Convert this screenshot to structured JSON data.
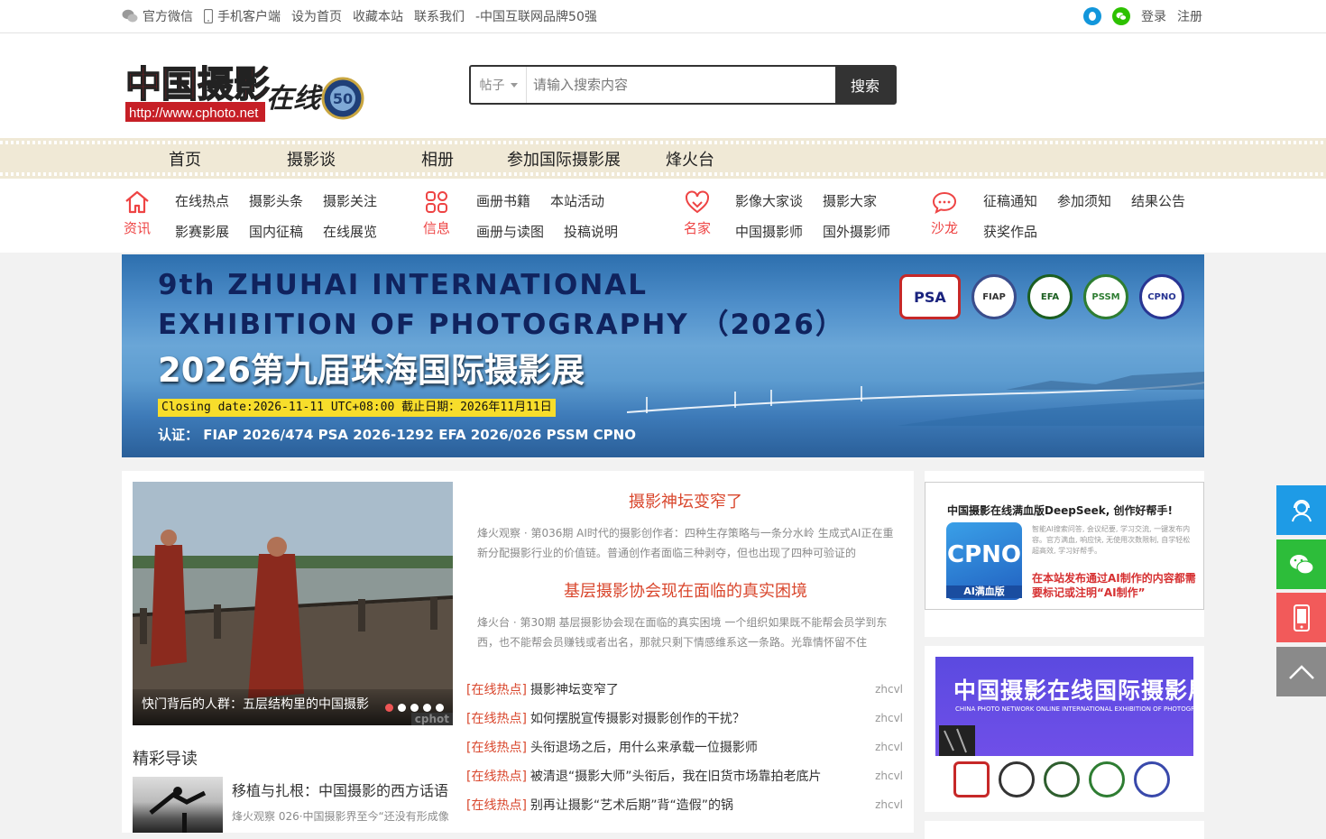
{
  "topbar": {
    "wechat": "官方微信",
    "mobile": "手机客户端",
    "set_home": "设为首页",
    "bookmark": "收藏本站",
    "contact": "联系我们",
    "brand": "-中国互联网品牌50强",
    "login": "登录",
    "register": "注册"
  },
  "logo": {
    "title": "中国摄影",
    "script": "在线",
    "url": "http://www.cphoto.net",
    "badge": "50"
  },
  "search": {
    "scope": "帖子",
    "placeholder": "请输入搜索内容",
    "button": "搜索"
  },
  "nav": [
    "首页",
    "摄影谈",
    "相册",
    "参加国际摄影展",
    "烽火台"
  ],
  "categories": [
    {
      "label": "资讯",
      "links": [
        "在线热点",
        "摄影头条",
        "摄影关注",
        "影赛影展",
        "国内征稿",
        "在线展览"
      ]
    },
    {
      "label": "信息",
      "links": [
        "画册书籍",
        "本站活动",
        "画册与读图",
        "投稿说明"
      ]
    },
    {
      "label": "名家",
      "links": [
        "影像大家谈",
        "摄影大家",
        "中国摄影师",
        "国外摄影师"
      ]
    },
    {
      "label": "沙龙",
      "links": [
        "征稿通知",
        "参加须知",
        "结果公告",
        "获奖作品"
      ]
    }
  ],
  "banner": {
    "line1": "9th ZHUHAI INTERNATIONAL",
    "line2": "EXHIBITION OF PHOTOGRAPHY （2026）",
    "line3": "2026第九届珠海国际摄影展",
    "closing": "Closing date:2026-11-11 UTC+08:00  截止日期：2026年11月11日",
    "cert": "认证： FIAP 2026/474   PSA 2026-1292   EFA 2026/026   PSSM   CPNO",
    "seals": [
      "PSA",
      "FIAP",
      "EFA",
      "PSSM",
      "CPNO"
    ]
  },
  "slide": {
    "caption": "快门背后的人群：五层结构里的中国摄影",
    "watermark": "cphot",
    "current": 1,
    "total": 5
  },
  "headlines": [
    {
      "title": "摄影神坛变窄了",
      "desc": "烽火观察 · 第036期 AI时代的摄影创作者：四种生存策略与一条分水岭 生成式AI正在重新分配摄影行业的价值链。普通创作者面临三种剥夺，但也出现了四种可验证的"
    },
    {
      "title": "基层摄影协会现在面临的真实困境",
      "desc": "烽火台 · 第30期 基层摄影协会现在面临的真实困境 一个组织如果既不能帮会员学到东西，也不能帮会员赚钱或者出名，那就只剩下情感维系这一条路。光靠情怀留不住"
    }
  ],
  "hot_list": [
    {
      "tag": "[在线热点]",
      "title": "摄影神坛变窄了",
      "author": "zhcvl"
    },
    {
      "tag": "[在线热点]",
      "title": "如何摆脱宣传摄影对摄影创作的干扰？",
      "author": "zhcvl"
    },
    {
      "tag": "[在线热点]",
      "title": "头衔退场之后，用什么来承载一位摄影师",
      "author": "zhcvl"
    },
    {
      "tag": "[在线热点]",
      "title": "被清退“摄影大师”头衔后，我在旧货市场靠拍老底片",
      "author": "zhcvl"
    },
    {
      "tag": "[在线热点]",
      "title": "别再让摄影“艺术后期”背“造假”的锅",
      "author": "zhcvl"
    }
  ],
  "guide": {
    "heading": "精彩导读",
    "title": "移植与扎根：中国摄影的西方话语",
    "desc": "烽火观察 026·中国摄影界至今“还没有形成像"
  },
  "ad1": {
    "headline": "中国摄影在线满血版DeepSeek, 创作好帮手!",
    "logo": "CPNO",
    "logo_sub": "AI满血版",
    "small": "智能AI搜索问答, 会议纪要, 学习交流, 一键发布内容。官方满血, 响应快, 无使用次数限制, 自学轻松超高效, 学习好帮手。",
    "notice": "在本站发布通过AI制作的内容都需要标记或注明“AI制作”"
  },
  "ad2": {
    "headline": "中国摄影在线国际摄影展",
    "subline": "CHINA PHOTO NETWORK ONLINE INTERNATIONAL EXHIBITION OF PHOTOGRAPHY"
  },
  "colors": {
    "accent": "#d9472d",
    "qq_blue": "#1296db",
    "wechat_green": "#2dc100",
    "float_blue": "#1e9be6",
    "float_green": "#2dbd3a",
    "float_red": "#f25a5a",
    "float_gray": "#8a8a8a"
  },
  "float_icons": [
    "customer-service-icon",
    "wechat-icon",
    "mobile-icon",
    "back-to-top-icon"
  ]
}
